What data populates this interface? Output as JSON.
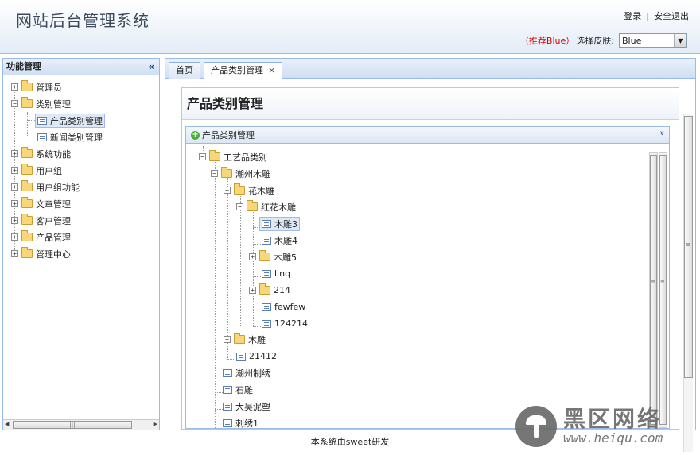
{
  "header": {
    "title": "网站后台管理系统",
    "login": "登录",
    "logout": "安全退出",
    "separator": "|",
    "skin_recommend": "（推荐Blue）",
    "skin_label": "选择皮肤:",
    "skin_value": "Blue"
  },
  "sidebar": {
    "title": "功能管理",
    "collapse_glyph": "«",
    "items": [
      {
        "label": "管理员",
        "type": "folder",
        "expand": "+"
      },
      {
        "label": "类别管理",
        "type": "folder",
        "expand": "−"
      },
      {
        "label": "产品类别管理",
        "type": "leaf"
      },
      {
        "label": "新闻类别管理",
        "type": "leaf"
      },
      {
        "label": "系统功能",
        "type": "folder",
        "expand": "+"
      },
      {
        "label": "用户组",
        "type": "folder",
        "expand": "+"
      },
      {
        "label": "用户组功能",
        "type": "folder",
        "expand": "+"
      },
      {
        "label": "文章管理",
        "type": "folder",
        "expand": "+"
      },
      {
        "label": "客户管理",
        "type": "folder",
        "expand": "+"
      },
      {
        "label": "产品管理",
        "type": "folder",
        "expand": "+"
      },
      {
        "label": "管理中心",
        "type": "folder",
        "expand": "+"
      }
    ]
  },
  "tabs": [
    {
      "label": "首页"
    },
    {
      "label": "产品类别管理",
      "close": "×"
    }
  ],
  "main": {
    "panel_title": "产品类别管理",
    "tree_panel_title": "产品类别管理",
    "tree_panel_tool": "»",
    "tree": [
      {
        "label": "工艺品类别",
        "type": "folder",
        "expand": "−"
      },
      {
        "label": "潮州木雕",
        "type": "folder",
        "expand": "−"
      },
      {
        "label": "花木雕",
        "type": "folder",
        "expand": "−"
      },
      {
        "label": "红花木雕",
        "type": "folder",
        "expand": "−"
      },
      {
        "label": "木雕3",
        "type": "leaf"
      },
      {
        "label": "木雕4",
        "type": "leaf"
      },
      {
        "label": "木雕5",
        "type": "folder",
        "expand": "+"
      },
      {
        "label": "linq",
        "type": "leaf"
      },
      {
        "label": "214",
        "type": "folder",
        "expand": "+"
      },
      {
        "label": "fewfew",
        "type": "leaf"
      },
      {
        "label": "124214",
        "type": "leaf"
      },
      {
        "label": "木雕",
        "type": "folder",
        "expand": "+"
      },
      {
        "label": "21412",
        "type": "leaf"
      },
      {
        "label": "潮州制绣",
        "type": "leaf"
      },
      {
        "label": "石雕",
        "type": "leaf"
      },
      {
        "label": "大吴泥塑",
        "type": "leaf"
      },
      {
        "label": "刺绣1",
        "type": "leaf"
      }
    ]
  },
  "footer": {
    "text": "本系统由sweet研发"
  },
  "watermark": {
    "brand": "黑区网络",
    "url": "www.heiqu.com"
  },
  "colors": {
    "border": "#99bbe8",
    "header_text": "#3a4a5c",
    "recommend_red": "#dd0000",
    "selected_bg": "#dfe8f6"
  }
}
